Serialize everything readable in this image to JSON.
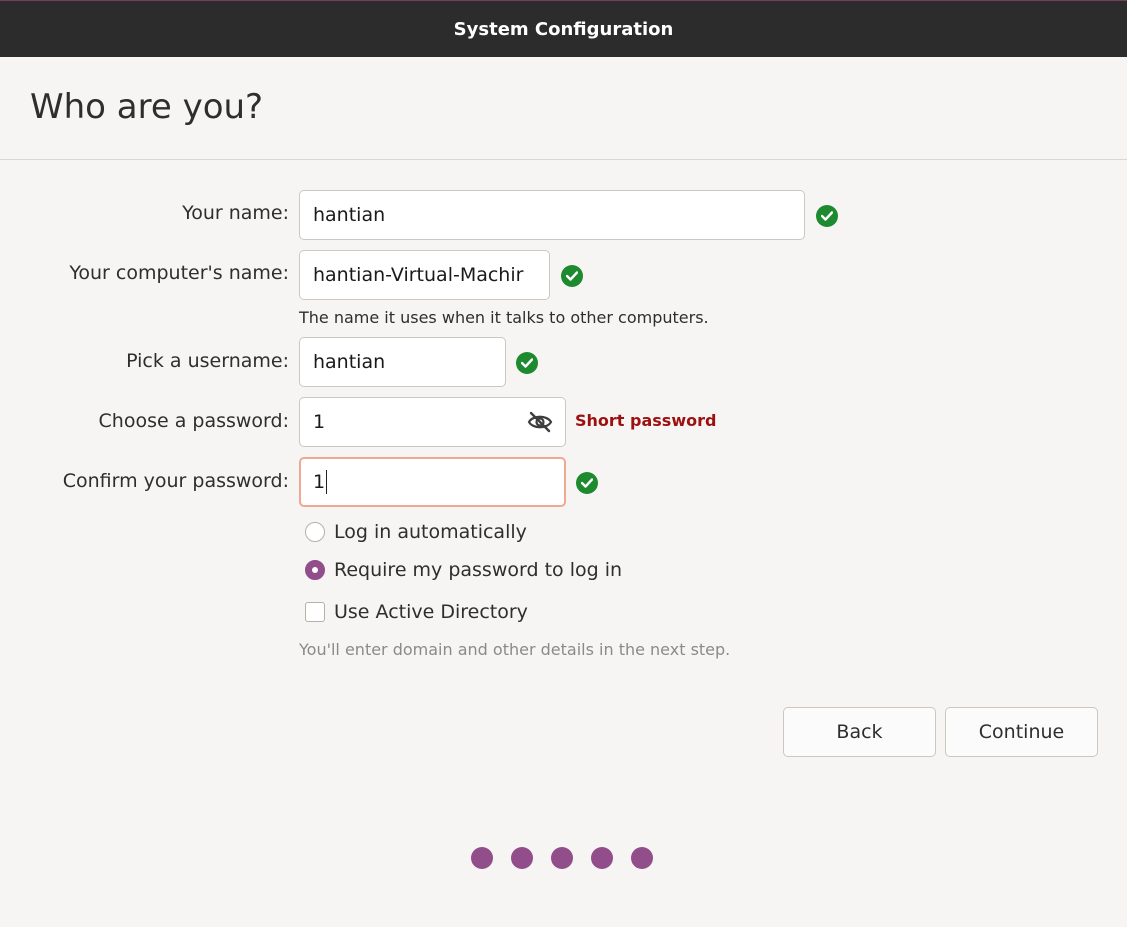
{
  "window": {
    "title": "System Configuration"
  },
  "page": {
    "heading": "Who are you?"
  },
  "form": {
    "name_label": "Your name:",
    "name_value": "hantian",
    "computer_label": "Your computer's name:",
    "computer_value": "hantian-Virtual-Machir",
    "computer_hint": "The name it uses when it talks to other computers.",
    "username_label": "Pick a username:",
    "username_value": "hantian",
    "password_label": "Choose a password:",
    "password_value": "1",
    "password_warning": "Short password",
    "confirm_label": "Confirm your password:",
    "confirm_value": "1"
  },
  "login_options": {
    "auto_label": "Log in automatically",
    "auto_selected": false,
    "require_label": "Require my password to log in",
    "require_selected": true,
    "ad_label": "Use Active Directory",
    "ad_checked": false,
    "ad_hint": "You'll enter domain and other details in the next step."
  },
  "buttons": {
    "back": "Back",
    "continue": "Continue"
  },
  "progress": {
    "steps": 5
  },
  "colors": {
    "accent": "#924d8b",
    "valid": "#1e8a2f",
    "warning": "#9c1010",
    "focus_border": "#f0a890"
  }
}
